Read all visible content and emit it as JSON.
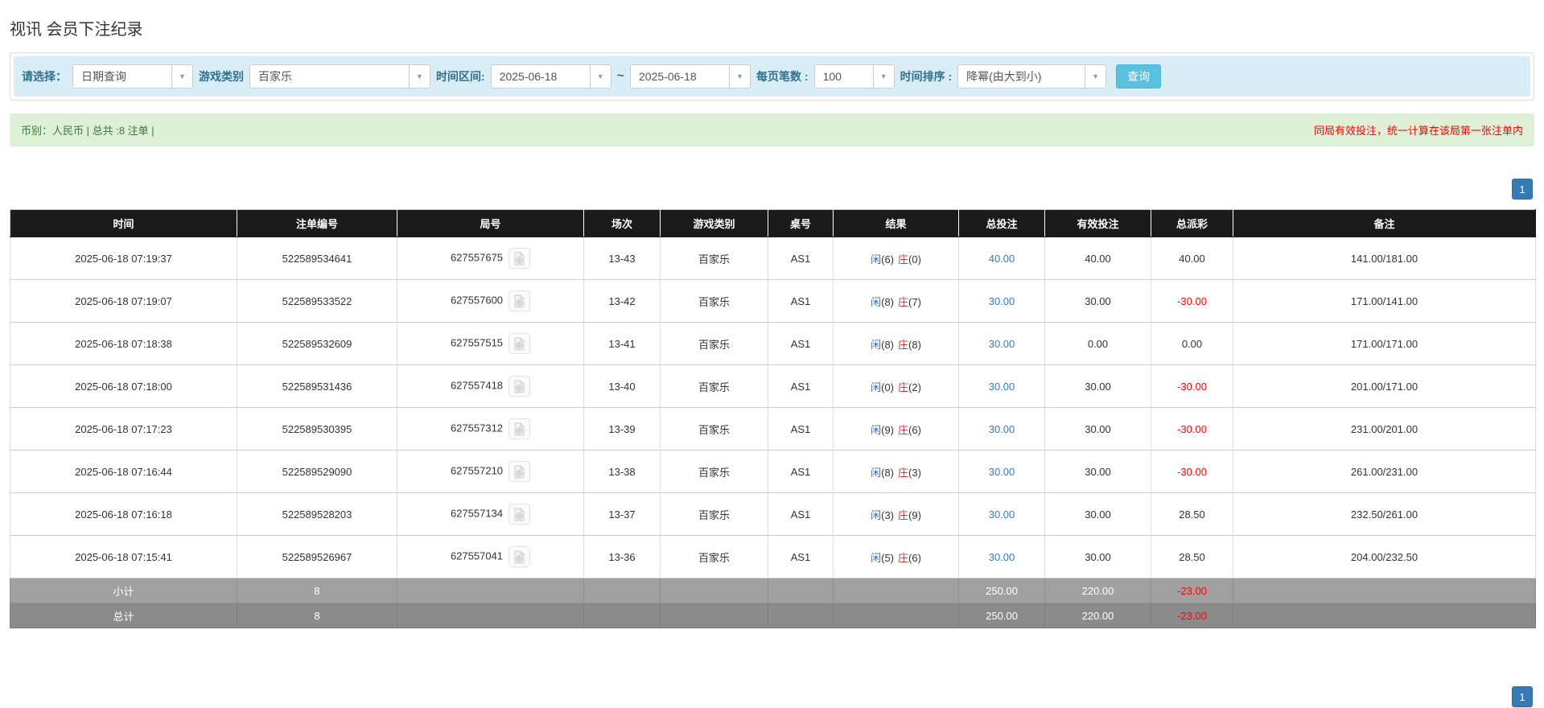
{
  "page": {
    "title": "视讯 会员下注纪录"
  },
  "filters": {
    "mode_label": "请选择：",
    "mode_value": "日期查询",
    "game_label": "游戏类别",
    "game_value": "百家乐",
    "range_label": "时间区间:",
    "date_from": "2025-06-18",
    "range_separator": "~",
    "date_to": "2025-06-18",
    "page_size_label": "每页笔数 :",
    "page_size_value": "100",
    "sort_label": "时间排序 :",
    "sort_value": "降幂(由大到小)",
    "query_button": "查询",
    "caret": "▼"
  },
  "summary": {
    "currency_info": "币别：人民币 | 总共 :8 注单 |",
    "notice": "同局有效投注，统一计算在该局第一张注单内"
  },
  "pagination": {
    "current_page": "1"
  },
  "colors": {
    "accent_blue": "#337ab7",
    "query_button": "#5bc0de",
    "player_blue": "#2a6fd6",
    "banker_red": "#e23030",
    "negative_red": "#ff0000",
    "header_black": "#1b1b1b",
    "filter_bg": "#d9edf7",
    "summary_bg": "#dff0d8"
  },
  "table": {
    "headers": [
      "时间",
      "注单编号",
      "局号",
      "场次",
      "游戏类别",
      "桌号",
      "结果",
      "总投注",
      "有效投注",
      "总派彩",
      "备注"
    ],
    "rows": [
      {
        "time": "2025-06-18 07:19:37",
        "bet_id": "522589534641",
        "round_id": "627557675",
        "session": "13-43",
        "game": "百家乐",
        "table_no": "AS1",
        "result": {
          "player_label": "闲",
          "player_score": "(6)",
          "banker_label": "庄",
          "banker_score": "(0)"
        },
        "total_bet": "40.00",
        "valid_bet": "40.00",
        "payout": "40.00",
        "remark": "141.00/181.00"
      },
      {
        "time": "2025-06-18 07:19:07",
        "bet_id": "522589533522",
        "round_id": "627557600",
        "session": "13-42",
        "game": "百家乐",
        "table_no": "AS1",
        "result": {
          "player_label": "闲",
          "player_score": "(8)",
          "banker_label": "庄",
          "banker_score": "(7)"
        },
        "total_bet": "30.00",
        "valid_bet": "30.00",
        "payout": "-30.00",
        "remark": "171.00/141.00"
      },
      {
        "time": "2025-06-18 07:18:38",
        "bet_id": "522589532609",
        "round_id": "627557515",
        "session": "13-41",
        "game": "百家乐",
        "table_no": "AS1",
        "result": {
          "player_label": "闲",
          "player_score": "(8)",
          "banker_label": "庄",
          "banker_score": "(8)"
        },
        "total_bet": "30.00",
        "valid_bet": "0.00",
        "payout": "0.00",
        "remark": "171.00/171.00"
      },
      {
        "time": "2025-06-18 07:18:00",
        "bet_id": "522589531436",
        "round_id": "627557418",
        "session": "13-40",
        "game": "百家乐",
        "table_no": "AS1",
        "result": {
          "player_label": "闲",
          "player_score": "(0)",
          "banker_label": "庄",
          "banker_score": "(2)"
        },
        "total_bet": "30.00",
        "valid_bet": "30.00",
        "payout": "-30.00",
        "remark": "201.00/171.00"
      },
      {
        "time": "2025-06-18 07:17:23",
        "bet_id": "522589530395",
        "round_id": "627557312",
        "session": "13-39",
        "game": "百家乐",
        "table_no": "AS1",
        "result": {
          "player_label": "闲",
          "player_score": "(9)",
          "banker_label": "庄",
          "banker_score": "(6)"
        },
        "total_bet": "30.00",
        "valid_bet": "30.00",
        "payout": "-30.00",
        "remark": "231.00/201.00"
      },
      {
        "time": "2025-06-18 07:16:44",
        "bet_id": "522589529090",
        "round_id": "627557210",
        "session": "13-38",
        "game": "百家乐",
        "table_no": "AS1",
        "result": {
          "player_label": "闲",
          "player_score": "(8)",
          "banker_label": "庄",
          "banker_score": "(3)"
        },
        "total_bet": "30.00",
        "valid_bet": "30.00",
        "payout": "-30.00",
        "remark": "261.00/231.00"
      },
      {
        "time": "2025-06-18 07:16:18",
        "bet_id": "522589528203",
        "round_id": "627557134",
        "session": "13-37",
        "game": "百家乐",
        "table_no": "AS1",
        "result": {
          "player_label": "闲",
          "player_score": "(3)",
          "banker_label": "庄",
          "banker_score": "(9)"
        },
        "total_bet": "30.00",
        "valid_bet": "30.00",
        "payout": "28.50",
        "remark": "232.50/261.00"
      },
      {
        "time": "2025-06-18 07:15:41",
        "bet_id": "522589526967",
        "round_id": "627557041",
        "session": "13-36",
        "game": "百家乐",
        "table_no": "AS1",
        "result": {
          "player_label": "闲",
          "player_score": "(5)",
          "banker_label": "庄",
          "banker_score": "(6)"
        },
        "total_bet": "30.00",
        "valid_bet": "30.00",
        "payout": "28.50",
        "remark": "204.00/232.50"
      }
    ],
    "footer": {
      "subtotal": {
        "label": "小计",
        "count": "8",
        "total_bet": "250.00",
        "valid_bet": "220.00",
        "payout": "-23.00"
      },
      "grand_total": {
        "label": "总计",
        "count": "8",
        "total_bet": "250.00",
        "valid_bet": "220.00",
        "payout": "-23.00"
      }
    }
  }
}
